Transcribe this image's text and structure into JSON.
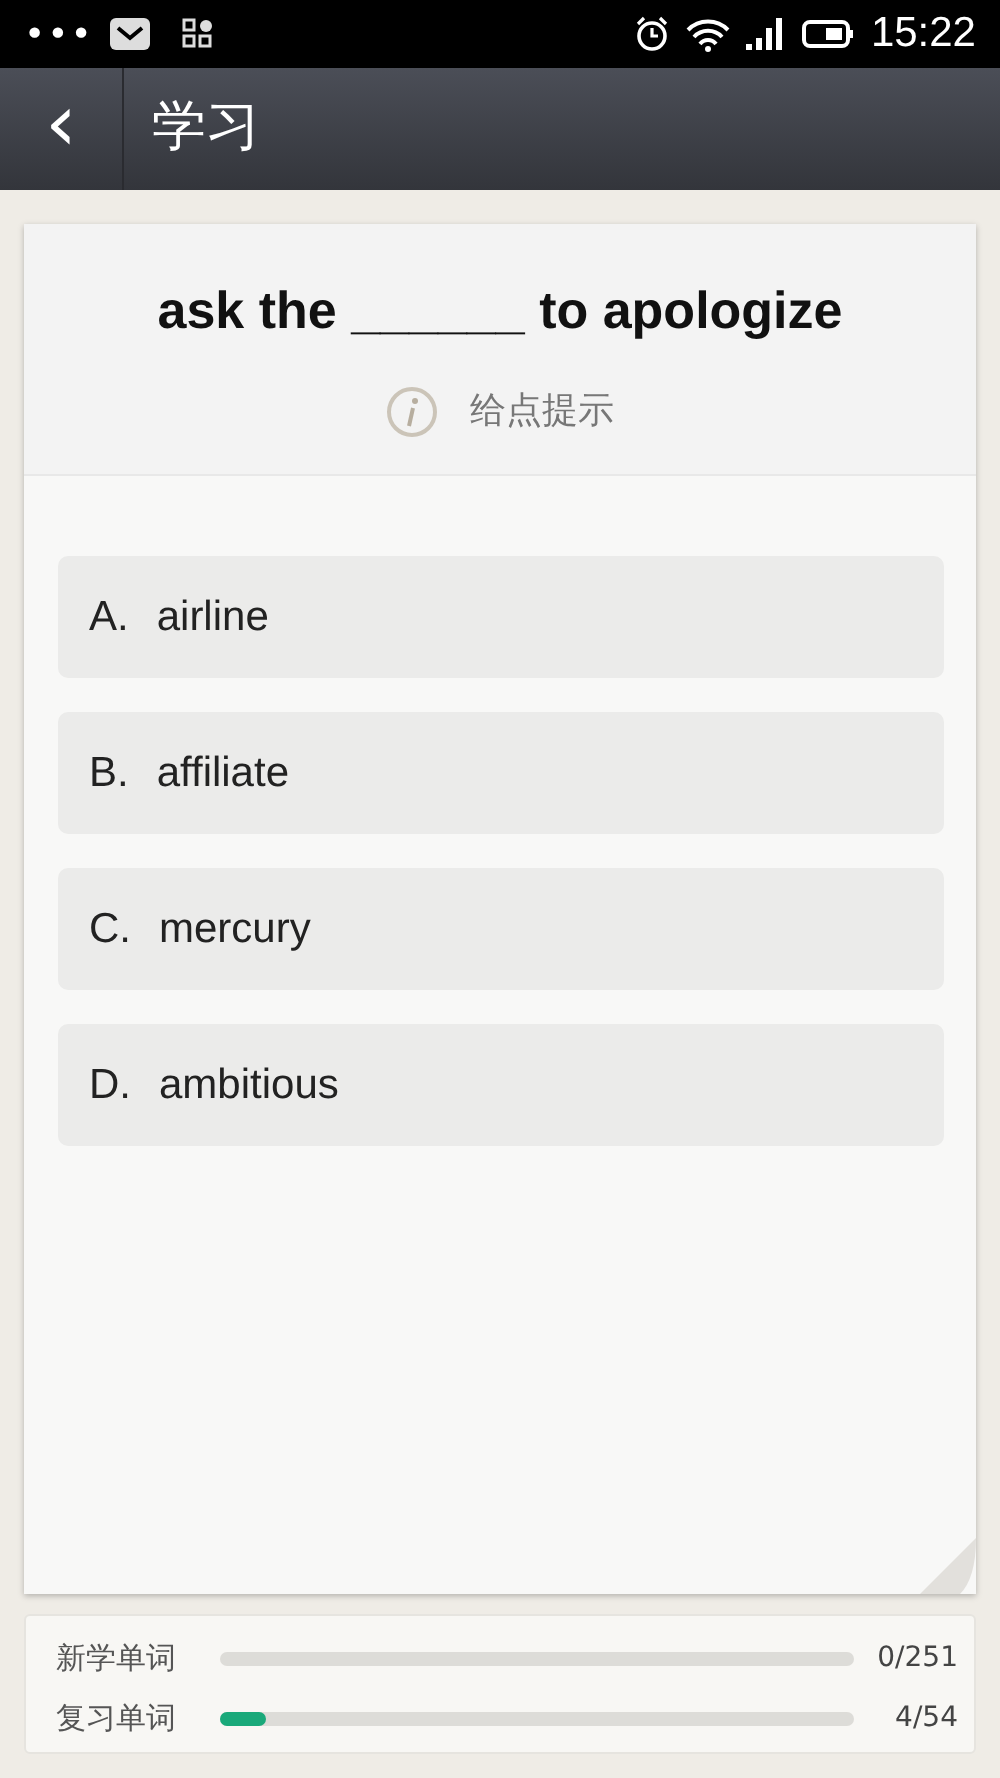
{
  "status_bar": {
    "menu": "•••",
    "time": "15:22"
  },
  "header": {
    "back": "‹",
    "title": "学习"
  },
  "question": {
    "text": "ask the ______ to apologize",
    "hint": "给点提示"
  },
  "options": [
    {
      "letter": "A.",
      "word": "airline"
    },
    {
      "letter": "B.",
      "word": "affiliate"
    },
    {
      "letter": "C.",
      "word": "mercury"
    },
    {
      "letter": "D.",
      "word": "ambitious"
    }
  ],
  "progress": [
    {
      "label": "新学单词",
      "count": "0/251"
    },
    {
      "label": "复习单词",
      "level": 0.074,
      "count": "4/54"
    }
  ]
}
